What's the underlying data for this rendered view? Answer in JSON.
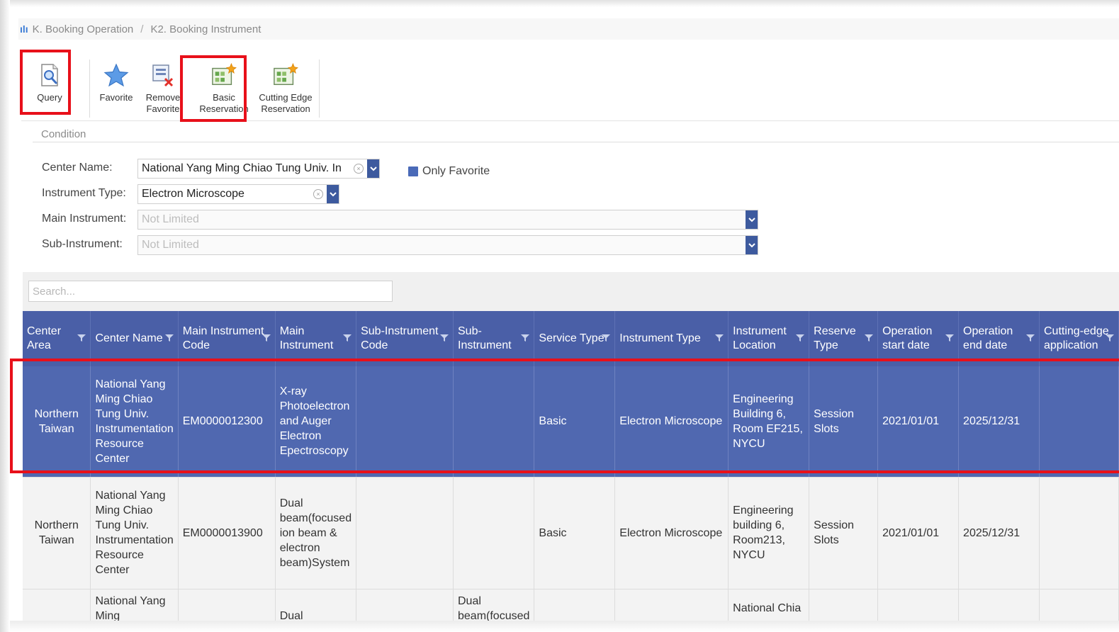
{
  "breadcrumb": {
    "home_icon": "ılı",
    "items": [
      "K. Booking Operation",
      "K2. Booking Instrument"
    ],
    "separator": "/"
  },
  "toolbar": {
    "query": "Query",
    "favorite": "Favorite",
    "remove_favorite_1": "Remove",
    "remove_favorite_2": "Favorite",
    "basic_reservation_1": "Basic",
    "basic_reservation_2": "Reservation",
    "cutting_edge_1": "Cutting Edge",
    "cutting_edge_2": "Reservation"
  },
  "condition": {
    "title": "Condition",
    "center_name_label": "Center Name:",
    "center_name_value": "National Yang Ming Chiao Tung Univ. In",
    "instrument_type_label": "Instrument Type:",
    "instrument_type_value": "Electron Microscope",
    "main_instrument_label": "Main Instrument:",
    "main_instrument_value": "Not Limited",
    "sub_instrument_label": "Sub-Instrument:",
    "sub_instrument_value": "Not Limited",
    "only_favorite": "Only Favorite"
  },
  "grid": {
    "search_placeholder": "Search...",
    "columns": [
      "Center Area",
      "Center Name",
      "Main Instrument Code",
      "Main Instrument",
      "Sub-Instrument Code",
      "Sub-Instrument",
      "Service Type",
      "Instrument Type",
      "Instrument Location",
      "Reserve Type",
      "Operation start date",
      "Operation end date",
      "Cutting-edge application"
    ],
    "rows": [
      {
        "center_area": "Northern Taiwan",
        "center_name": "National Yang Ming Chiao Tung Univ. Instrumentation Resource Center",
        "main_code": "EM0000012300",
        "main_instrument": "X-ray Photoelectron and Auger Electron Epectroscopy",
        "sub_code": "",
        "sub_instrument": "",
        "service_type": "Basic",
        "instrument_type": "Electron Microscope",
        "location": "Engineering Building 6, Room EF215, NYCU",
        "reserve_type": "Session Slots",
        "start": "2021/01/01",
        "end": "2025/12/31",
        "cutting_edge": ""
      },
      {
        "center_area": "Northern Taiwan",
        "center_name": "National Yang Ming Chiao Tung Univ. Instrumentation Resource Center",
        "main_code": "EM0000013900",
        "main_instrument": "Dual beam(focused ion beam & electron beam)System",
        "sub_code": "",
        "sub_instrument": "",
        "service_type": "Basic",
        "instrument_type": "Electron Microscope",
        "location": "Engineering building 6, Room213, NYCU",
        "reserve_type": "Session Slots",
        "start": "2021/01/01",
        "end": "2025/12/31",
        "cutting_edge": ""
      },
      {
        "center_area": "",
        "center_name": "National Yang Ming",
        "main_code": "",
        "main_instrument": "Dual",
        "sub_code": "",
        "sub_instrument": "Dual beam(focused",
        "service_type": "",
        "instrument_type": "",
        "location": "National Chia",
        "reserve_type": "",
        "start": "",
        "end": "",
        "cutting_edge": ""
      }
    ]
  },
  "colors": {
    "accent": "#4a5fa7",
    "selected_row": "#5068b0",
    "highlight": "#e8101a"
  }
}
